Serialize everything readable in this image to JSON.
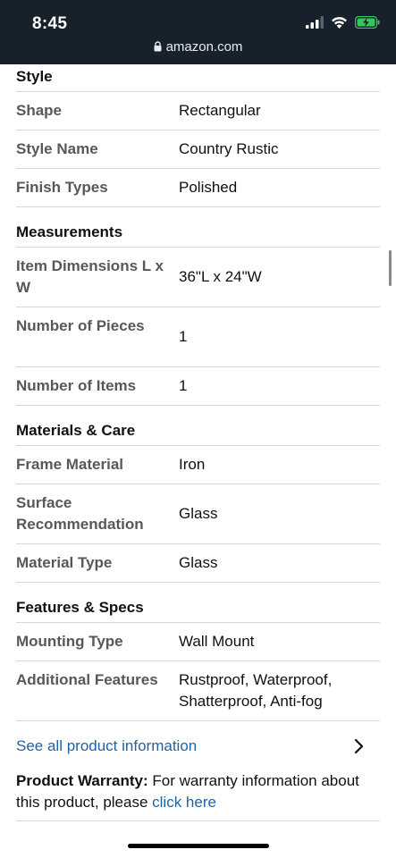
{
  "status": {
    "time": "8:45",
    "url": "amazon.com",
    "battery_color": "#34c759"
  },
  "sections": [
    {
      "title": "Style",
      "rows": [
        {
          "label": "Shape",
          "value": "Rectangular"
        },
        {
          "label": "Style Name",
          "value": "Country Rustic"
        },
        {
          "label": "Finish Types",
          "value": "Polished"
        }
      ]
    },
    {
      "title": "Measurements",
      "rows": [
        {
          "label": "Item Dimensions L x W",
          "value": "36\"L x 24\"W"
        },
        {
          "label": "Number of Pieces",
          "value": "1"
        },
        {
          "label": "Number of Items",
          "value": "1"
        }
      ]
    },
    {
      "title": "Materials & Care",
      "rows": [
        {
          "label": "Frame Material",
          "value": "Iron"
        },
        {
          "label": "Surface Recommendation",
          "value": "Glass"
        },
        {
          "label": "Material Type",
          "value": "Glass"
        }
      ]
    },
    {
      "title": "Features & Specs",
      "rows": [
        {
          "label": "Mounting Type",
          "value": "Wall Mount"
        },
        {
          "label": "Additional Features",
          "value": "Rustproof, Waterproof, Shatterproof, Anti-fog"
        }
      ]
    }
  ],
  "see_all_label": "See all product information",
  "warranty": {
    "bold": "Product Warranty:",
    "text": " For warranty information about this product, please ",
    "link": "click here"
  },
  "colors": {
    "link": "#2162a1",
    "label": "#565959",
    "divider": "#d5d9d9",
    "status_bg": "#17212c"
  }
}
